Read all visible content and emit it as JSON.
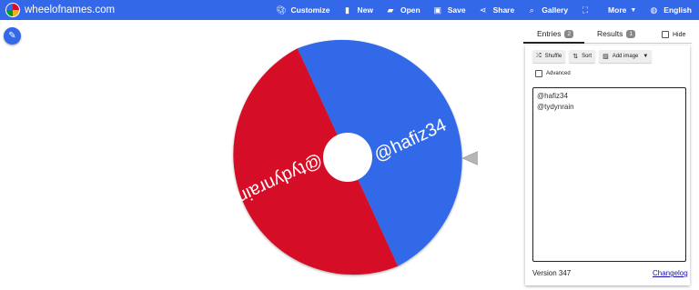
{
  "brand": {
    "title": "wheelofnames.com"
  },
  "nav": {
    "items": [
      {
        "icon": "palette-icon",
        "label": "Customize"
      },
      {
        "icon": "new-file-icon",
        "label": "New"
      },
      {
        "icon": "folder-open-icon",
        "label": "Open"
      },
      {
        "icon": "save-icon",
        "label": "Save"
      },
      {
        "icon": "share-icon",
        "label": "Share"
      },
      {
        "icon": "search-icon",
        "label": "Gallery"
      },
      {
        "icon": "fullscreen-icon",
        "label": ""
      },
      {
        "icon": "chevron-down-icon",
        "label": "More"
      },
      {
        "icon": "globe-icon",
        "label": "English"
      }
    ]
  },
  "wheel": {
    "segments": [
      {
        "label": "@hafiz34",
        "color": "#3369e8"
      },
      {
        "label": "@tydynrain",
        "color": "#d50f25"
      }
    ]
  },
  "panel": {
    "tabs": [
      {
        "label": "Entries",
        "count": "2"
      },
      {
        "label": "Results",
        "count": "1"
      }
    ],
    "hide_label": "Hide",
    "buttons": {
      "shuffle": "Shuffle",
      "sort": "Sort",
      "add_image": "Add image"
    },
    "advanced_label": "Advanced",
    "entries": [
      "@hafiz34",
      "@tydynrain"
    ],
    "version": "Version 347",
    "changelog": "Changelog"
  },
  "colors": {
    "brand_blue": "#3369e8",
    "wheel_red": "#d50f25"
  }
}
